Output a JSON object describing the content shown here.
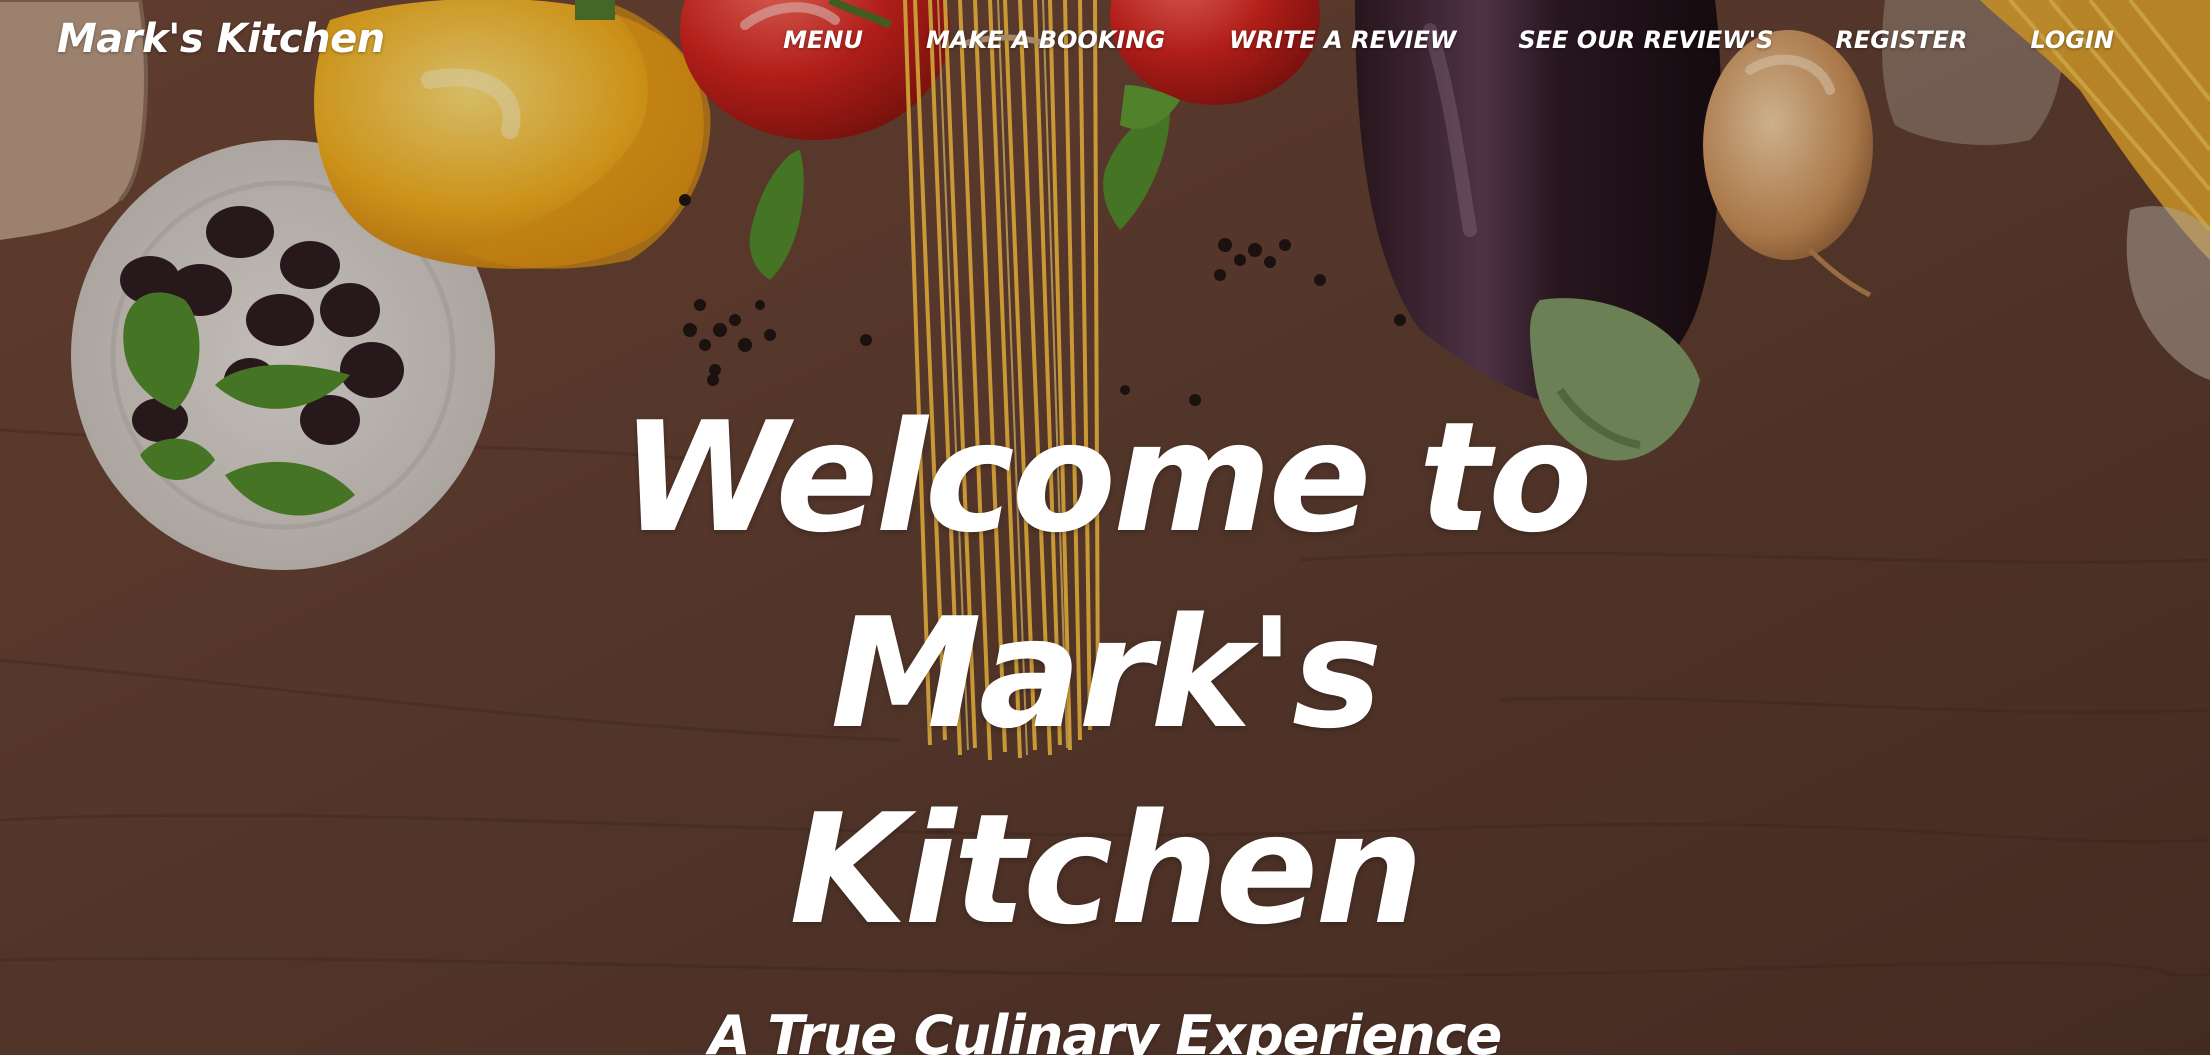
{
  "brand": {
    "name": "Mark's Kitchen"
  },
  "nav": {
    "items": [
      {
        "label": "MENU"
      },
      {
        "label": "MAKE A BOOKING"
      },
      {
        "label": "WRITE A REVIEW"
      },
      {
        "label": "SEE OUR REVIEW'S"
      },
      {
        "label": "REGISTER"
      },
      {
        "label": "LOGIN"
      }
    ]
  },
  "hero": {
    "title_line1": "Welcome to",
    "title_line2": "Mark's Kitchen",
    "subtitle": "A True Culinary Experience"
  },
  "colors": {
    "text": "#ffffff",
    "wood": "#6b4534"
  }
}
